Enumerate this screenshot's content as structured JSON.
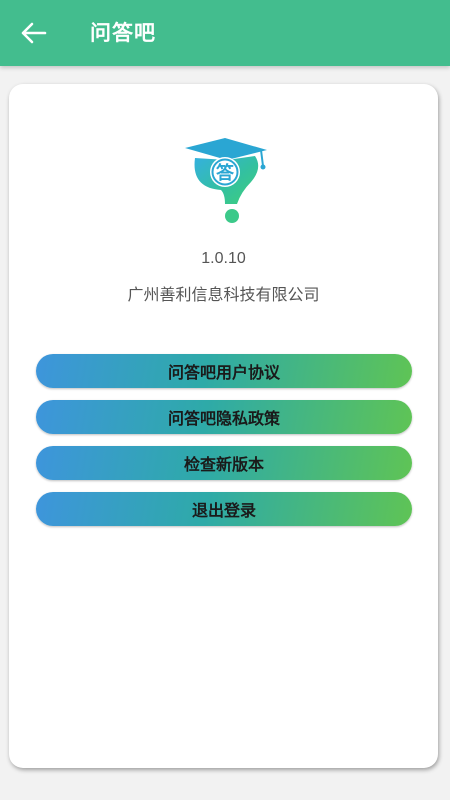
{
  "header": {
    "title": "问答吧",
    "back_icon": "arrow-left-icon",
    "background_color": "#43bd8e"
  },
  "about": {
    "logo_text": "答",
    "logo_icon": "graduation-cap-question-logo",
    "version": "1.0.10",
    "company": "广州善利信息科技有限公司"
  },
  "buttons": [
    {
      "label": "问答吧用户协议"
    },
    {
      "label": "问答吧隐私政策"
    },
    {
      "label": "检查新版本"
    },
    {
      "label": "退出登录"
    }
  ]
}
